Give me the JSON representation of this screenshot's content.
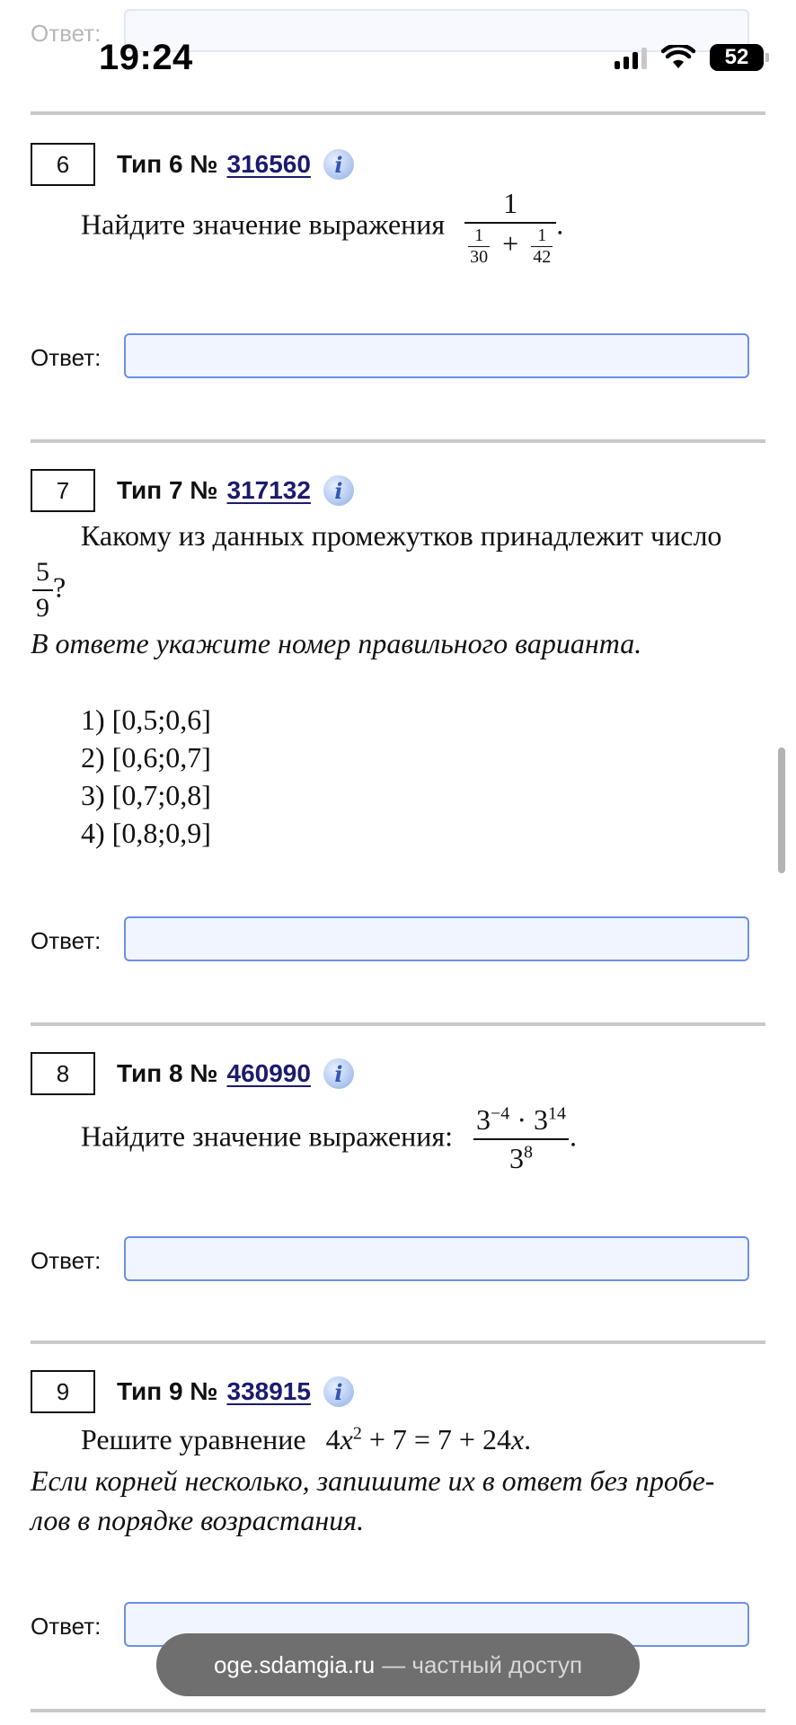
{
  "status_bar": {
    "time": "19:24",
    "battery": "52",
    "icons": [
      "signal-icon",
      "wifi-icon",
      "battery-icon"
    ]
  },
  "partial_top": {
    "answer_label": "Ответ:"
  },
  "tasks": [
    {
      "number": "6",
      "type_label": "Тип 6 №",
      "id": "316560",
      "prompt": "Найдите значение выражения",
      "expr": {
        "num": "1",
        "a_num": "1",
        "a_den": "30",
        "op": "+",
        "b_num": "1",
        "b_den": "42",
        "end": "."
      },
      "answer_label": "Ответ:",
      "answer_value": ""
    },
    {
      "number": "7",
      "type_label": "Тип 7 №",
      "id": "317132",
      "prompt": "Какому из данных промежутков принадлежит число",
      "fraction": {
        "num": "5",
        "den": "9",
        "end": "?"
      },
      "instruction": "В ответе укажите номер правильного варианта.",
      "options": [
        "1) [0,5;0,6]",
        "2) [0,6;0,7]",
        "3) [0,7;0,8]",
        "4) [0,8;0,9]"
      ],
      "answer_label": "Ответ:",
      "answer_value": ""
    },
    {
      "number": "8",
      "type_label": "Тип 8 №",
      "id": "460990",
      "prompt": "Найдите значение выражения:",
      "expr": {
        "base1": "3",
        "exp1": "−4",
        "dot": "·",
        "base2": "3",
        "exp2": "14",
        "den_base": "3",
        "den_exp": "8",
        "end": "."
      },
      "answer_label": "Ответ:",
      "answer_value": ""
    },
    {
      "number": "9",
      "type_label": "Тип 9 №",
      "id": "338915",
      "prompt": "Решите уравнение",
      "eq": {
        "a": "4",
        "x": "x",
        "exp": "2",
        "rest": "+ 7 = 7 + 24",
        "x2": "x",
        "end": "."
      },
      "instruction_line1": "Если корней несколько, запишите их в ответ без пробе-",
      "instruction_line2": "лов в порядке возрастания.",
      "answer_label": "Ответ:",
      "answer_value": ""
    }
  ],
  "toast": {
    "domain": "oge.sdamgia.ru",
    "note": "— частный доступ"
  },
  "colors": {
    "link": "#1b1b6e",
    "field_border": "#6b8fe3",
    "field_bg": "#f1f5ff",
    "rule": "#c9c9c9",
    "toast_bg": "#6f6f6f"
  }
}
